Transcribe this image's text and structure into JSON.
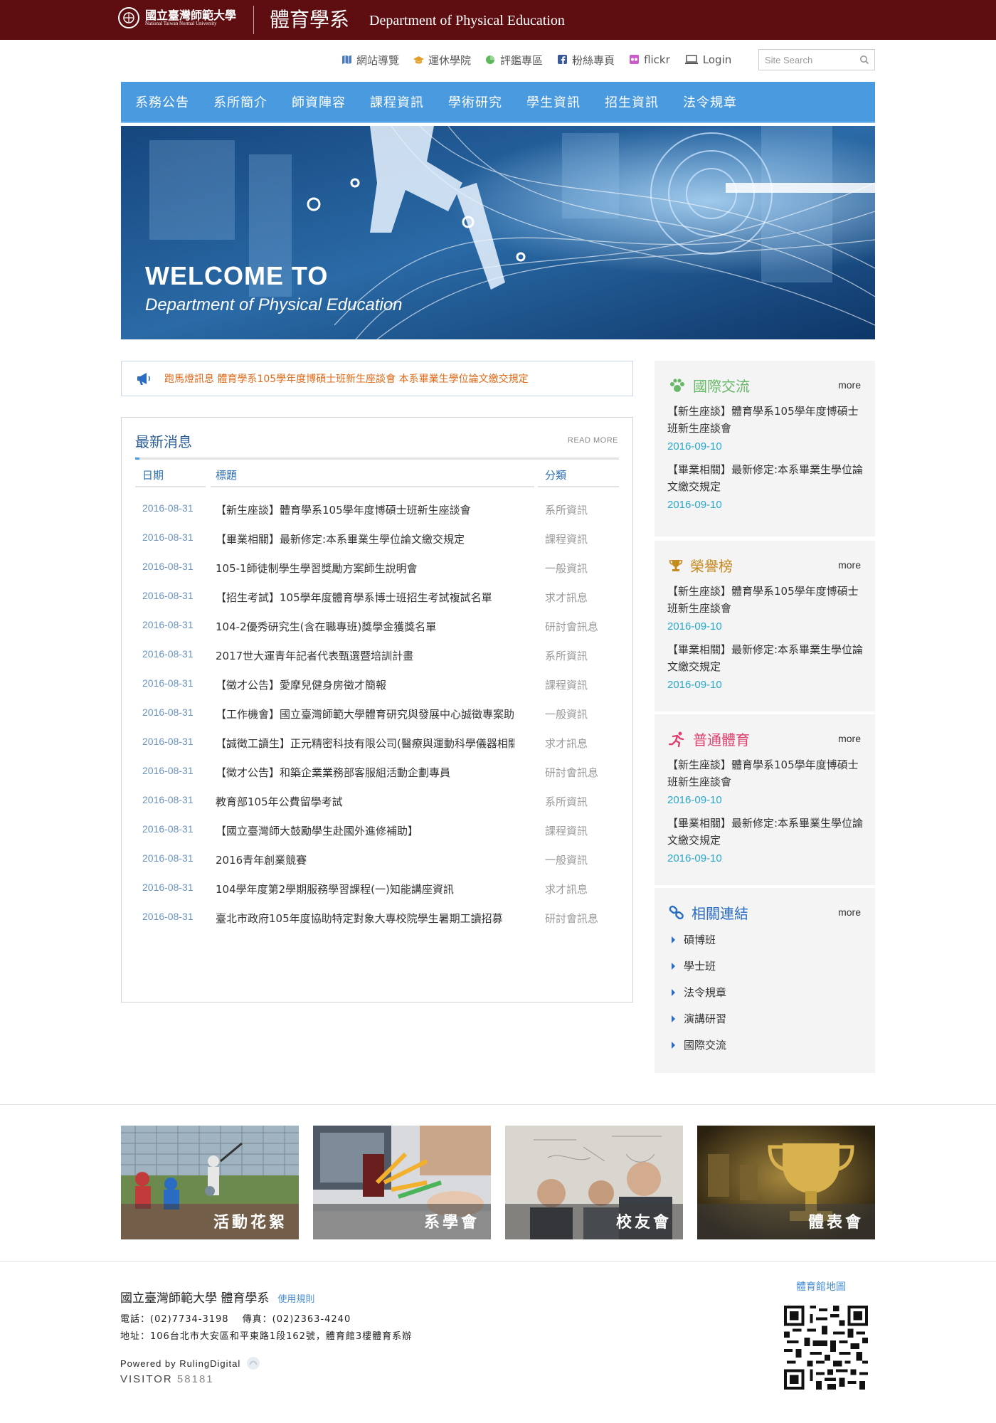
{
  "header": {
    "logo_cn": "國立臺灣師範大學",
    "logo_en": "National Taiwan Normal University",
    "dept_cn": "體育學系",
    "dept_en": "Department of Physical Education",
    "bg_color": "#5e0d10"
  },
  "utility": {
    "links": [
      {
        "label": "網站導覽",
        "icon": "map-icon"
      },
      {
        "label": "運休學院",
        "icon": "graduation-cap-icon"
      },
      {
        "label": "評鑑專區",
        "icon": "pie-chart-icon"
      },
      {
        "label": "粉絲專頁",
        "icon": "facebook-icon"
      },
      {
        "label": "flickr",
        "icon": "flickr-icon"
      },
      {
        "label": "Login",
        "icon": "laptop-icon"
      }
    ],
    "search_placeholder": "Site Search"
  },
  "nav": {
    "items": [
      "系務公告",
      "系所簡介",
      "師資陣容",
      "課程資訊",
      "學術研究",
      "學生資訊",
      "招生資訊",
      "法令規章"
    ],
    "bg_color": "#4a9ae0"
  },
  "banner": {
    "line1": "WELCOME TO",
    "line2": "Department of Physical Education"
  },
  "ticker": {
    "text": "跑馬燈訊息  體育學系105學年度博碩士班新生座談會 本系畢業生學位論文繳交規定"
  },
  "news": {
    "title": "最新消息",
    "more": "READ MORE",
    "col_date": "日期",
    "col_title": "標題",
    "col_category": "分類",
    "rows": [
      {
        "date": "2016-08-31",
        "title": "【新生座談】體育學系105學年度博碩士班新生座談會",
        "category": "系所資訊"
      },
      {
        "date": "2016-08-31",
        "title": "【畢業相關】最新修定:本系畢業生學位論文繳交規定",
        "category": "課程資訊"
      },
      {
        "date": "2016-08-31",
        "title": "105-1師徒制學生學習獎勵方案師生說明會",
        "category": "一般資訊"
      },
      {
        "date": "2016-08-31",
        "title": "【招生考試】105學年度體育學系博士班招生考試複試名單",
        "category": "求才訊息"
      },
      {
        "date": "2016-08-31",
        "title": "104-2優秀研究生(含在職專班)獎學金獲獎名單",
        "category": "研討會訊息"
      },
      {
        "date": "2016-08-31",
        "title": "2017世大運青年記者代表甄選暨培訓計畫",
        "category": "系所資訊"
      },
      {
        "date": "2016-08-31",
        "title": "【徵才公告】愛摩兒健身房徵才簡報",
        "category": "課程資訊"
      },
      {
        "date": "2016-08-31",
        "title": "【工作機會】國立臺灣師範大學體育研究與發展中心誠徵專案助理",
        "category": "一般資訊"
      },
      {
        "date": "2016-08-31",
        "title": "【誠徵工讀生】正元精密科技有限公司(醫療與運動科學儀器相關)",
        "category": "求才訊息"
      },
      {
        "date": "2016-08-31",
        "title": "【徵才公告】和築企業業務部客服組活動企劃專員",
        "category": "研討會訊息"
      },
      {
        "date": "2016-08-31",
        "title": "教育部105年公費留學考試",
        "category": "系所資訊"
      },
      {
        "date": "2016-08-31",
        "title": "【國立臺灣師大鼓勵學生赴國外進修補助】",
        "category": "課程資訊"
      },
      {
        "date": "2016-08-31",
        "title": "2016青年創業競賽",
        "category": "一般資訊"
      },
      {
        "date": "2016-08-31",
        "title": "104學年度第2學期服務學習課程(一)知能講座資訊",
        "category": "求才訊息"
      },
      {
        "date": "2016-08-31",
        "title": "臺北市政府105年度協助特定對象大專校院學生暑期工讀招募",
        "category": "研討會訊息"
      }
    ]
  },
  "sidebar": {
    "panels": [
      {
        "title": "國際交流",
        "icon": "paw-icon",
        "color": "#68b86a",
        "more": "more",
        "items": [
          {
            "title": "【新生座談】體育學系105學年度博碩士班新生座談會",
            "date": "2016-09-10"
          },
          {
            "title": "【畢業相關】最新修定:本系畢業生學位論文繳交規定",
            "date": "2016-09-10"
          }
        ]
      },
      {
        "title": "榮譽榜",
        "icon": "trophy-icon",
        "color": "#c48a1c",
        "more": "more",
        "items": [
          {
            "title": "【新生座談】體育學系105學年度博碩士班新生座談會",
            "date": "2016-09-10"
          },
          {
            "title": "【畢業相關】最新修定:本系畢業生學位論文繳交規定",
            "date": "2016-09-10"
          }
        ]
      },
      {
        "title": "普通體育",
        "icon": "runner-icon",
        "color": "#e0406e",
        "more": "more",
        "items": [
          {
            "title": "【新生座談】體育學系105學年度博碩士班新生座談會",
            "date": "2016-09-10"
          },
          {
            "title": "【畢業相關】最新修定:本系畢業生學位論文繳交規定",
            "date": "2016-09-10"
          }
        ]
      },
      {
        "title": "相關連結",
        "icon": "link-icon",
        "color": "#2a6cc4",
        "more": "more",
        "links": [
          "碩博班",
          "學士班",
          "法令規章",
          "演講研習",
          "國際交流"
        ]
      }
    ]
  },
  "tiles": [
    {
      "label": "活動花絮"
    },
    {
      "label": "系學會"
    },
    {
      "label": "校友會"
    },
    {
      "label": "體表會"
    }
  ],
  "footer": {
    "org": "國立臺灣師範大學  體育學系",
    "terms": "使用規則",
    "phone": "電話：(02)7734-3198　 傳真：(02)2363-4240",
    "address": "地址：106台北市大安區和平東路1段162號，體育館3樓體育系辦",
    "powered": "Powered by RulingDigital",
    "visitor_label": "VISITOR",
    "visitor_count": "58181",
    "map_link": "體育館地圖"
  }
}
